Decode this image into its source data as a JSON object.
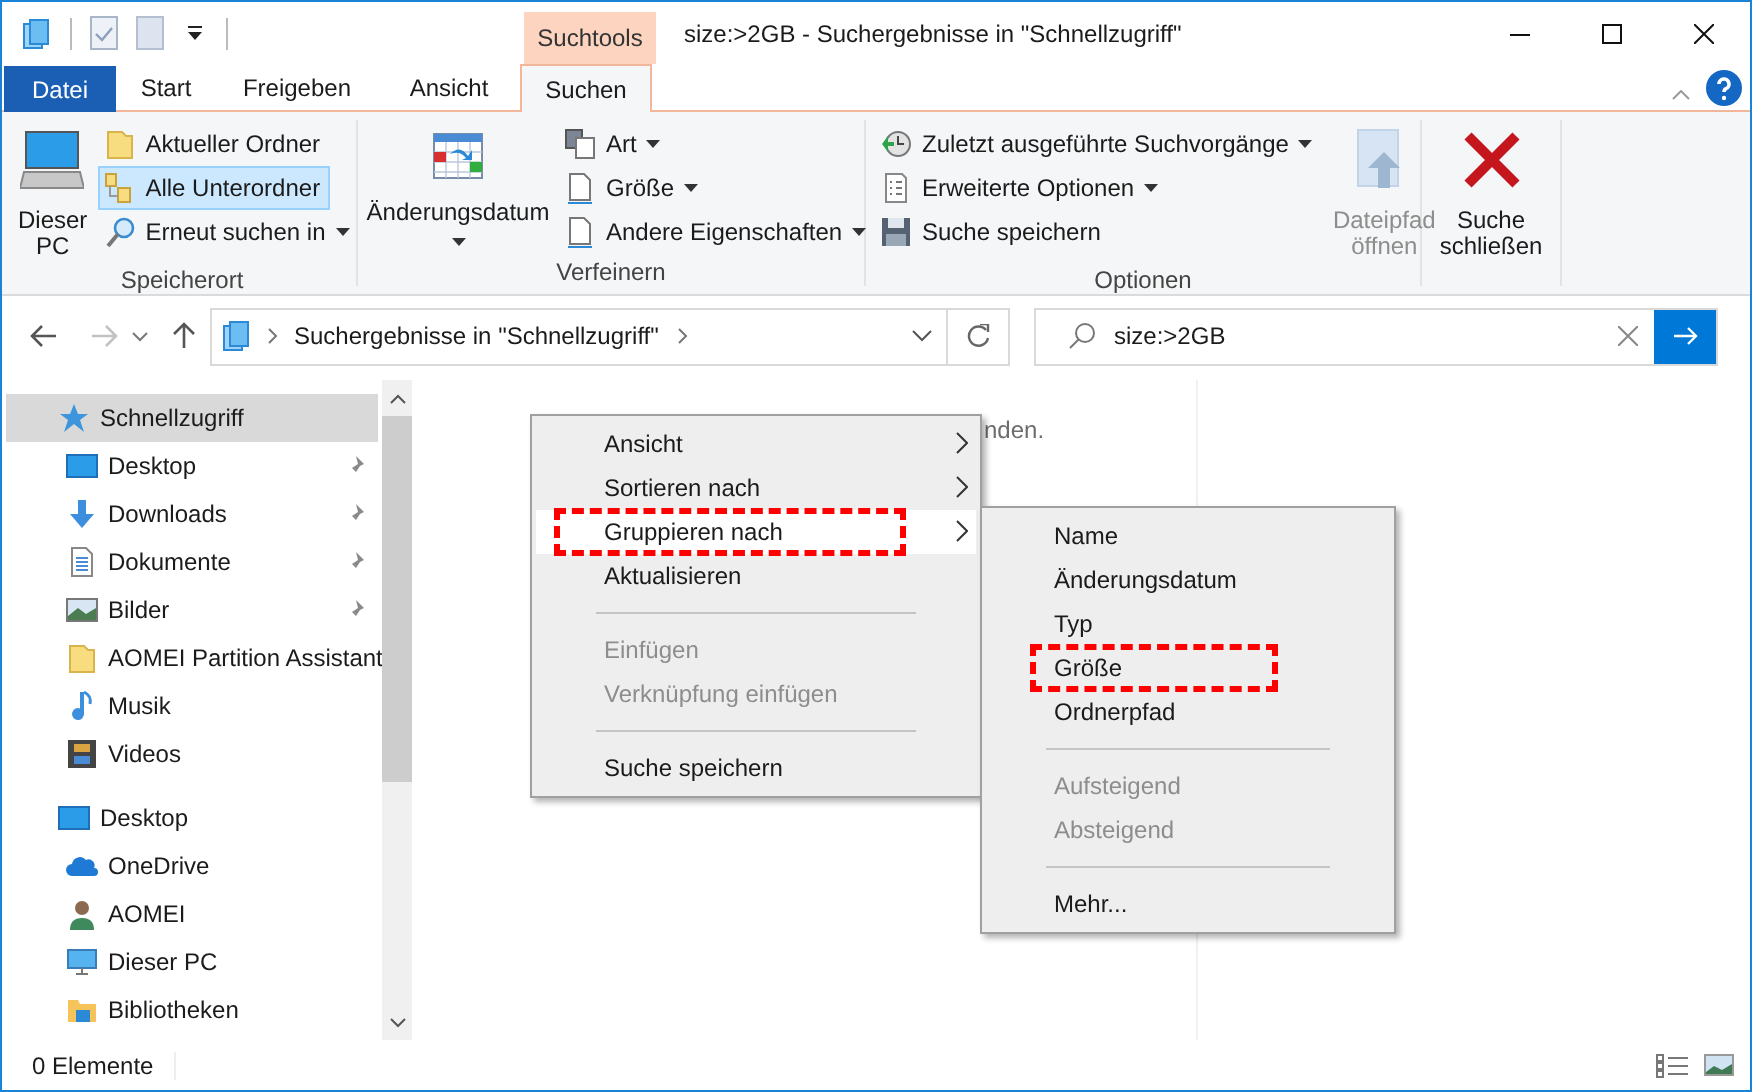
{
  "window": {
    "title": "size:>2GB - Suchergebnisse in \"Schnellzugriff\"",
    "contextual_tab": "Suchtools"
  },
  "ribbon_tabs": [
    {
      "label": "Datei",
      "kind": "file",
      "selected": false
    },
    {
      "label": "Start",
      "kind": "tab",
      "selected": false
    },
    {
      "label": "Freigeben",
      "kind": "tab",
      "selected": false
    },
    {
      "label": "Ansicht",
      "kind": "tab",
      "selected": false
    },
    {
      "label": "Suchen",
      "kind": "tab",
      "selected": true
    }
  ],
  "ribbon_groups": [
    {
      "label": "Speicherort",
      "items": [
        {
          "label": "Dieser PC",
          "kind": "large",
          "dropdown": false,
          "selected": false,
          "disabled": false
        },
        {
          "label": "Aktueller Ordner",
          "kind": "small",
          "dropdown": false,
          "selected": false,
          "disabled": false
        },
        {
          "label": "Alle Unterordner",
          "kind": "small",
          "dropdown": false,
          "selected": true,
          "disabled": false
        },
        {
          "label": "Erneut suchen in",
          "kind": "small",
          "dropdown": true,
          "selected": false,
          "disabled": false
        }
      ]
    },
    {
      "label": "Verfeinern",
      "items": [
        {
          "label": "Änderungsdatum",
          "kind": "large",
          "dropdown": true,
          "selected": false,
          "disabled": false
        },
        {
          "label": "Art",
          "kind": "small",
          "dropdown": true,
          "selected": false,
          "disabled": false
        },
        {
          "label": "Größe",
          "kind": "small",
          "dropdown": true,
          "selected": false,
          "disabled": false
        },
        {
          "label": "Andere Eigenschaften",
          "kind": "small",
          "dropdown": true,
          "selected": false,
          "disabled": false
        }
      ]
    },
    {
      "label": "Optionen",
      "items": [
        {
          "label": "Zuletzt ausgeführte Suchvorgänge",
          "kind": "small",
          "dropdown": true,
          "selected": false,
          "disabled": false
        },
        {
          "label": "Erweiterte Optionen",
          "kind": "small",
          "dropdown": true,
          "selected": false,
          "disabled": false
        },
        {
          "label": "Suche speichern",
          "kind": "small",
          "dropdown": false,
          "selected": false,
          "disabled": false
        },
        {
          "label": "Dateipfad öffnen",
          "kind": "large",
          "dropdown": false,
          "selected": false,
          "disabled": true
        }
      ]
    },
    {
      "items": [
        {
          "label": "Suche schließen",
          "kind": "large",
          "dropdown": false,
          "selected": false,
          "disabled": false
        }
      ]
    }
  ],
  "address_bar": {
    "path": "Suchergebnisse in \"Schnellzugriff\""
  },
  "search": {
    "value": "size:>2GB"
  },
  "navigation": [
    {
      "label": "Schnellzugriff",
      "selected": true,
      "children": [
        {
          "label": "Desktop",
          "pinned": true
        },
        {
          "label": "Downloads",
          "pinned": true
        },
        {
          "label": "Dokumente",
          "pinned": true
        },
        {
          "label": "Bilder",
          "pinned": true
        },
        {
          "label": "AOMEI Partition Assistant",
          "pinned": false
        },
        {
          "label": "Musik",
          "pinned": false
        },
        {
          "label": "Videos",
          "pinned": false
        }
      ]
    },
    {
      "label": "Desktop",
      "selected": false,
      "children": [
        {
          "label": "OneDrive",
          "pinned": false
        },
        {
          "label": "AOMEI",
          "pinned": false
        },
        {
          "label": "Dieser PC",
          "pinned": false
        },
        {
          "label": "Bibliotheken",
          "pinned": false
        }
      ]
    }
  ],
  "content_message": "nden.",
  "context_menu": [
    {
      "kind": "item",
      "label": "Ansicht",
      "submenu": true,
      "disabled": false,
      "selected": false,
      "annotated": false
    },
    {
      "kind": "item",
      "label": "Sortieren nach",
      "submenu": true,
      "disabled": false,
      "selected": false,
      "annotated": false
    },
    {
      "kind": "item",
      "label": "Gruppieren nach",
      "submenu": true,
      "disabled": false,
      "selected": true,
      "annotated": true
    },
    {
      "kind": "item",
      "label": "Aktualisieren",
      "submenu": false,
      "disabled": false,
      "selected": false,
      "annotated": false
    },
    {
      "kind": "separator"
    },
    {
      "kind": "item",
      "label": "Einfügen",
      "submenu": false,
      "disabled": true,
      "selected": false,
      "annotated": false
    },
    {
      "kind": "item",
      "label": "Verknüpfung einfügen",
      "submenu": false,
      "disabled": true,
      "selected": false,
      "annotated": false
    },
    {
      "kind": "separator"
    },
    {
      "kind": "item",
      "label": "Suche speichern",
      "submenu": false,
      "disabled": false,
      "selected": false,
      "annotated": false
    }
  ],
  "submenu": [
    {
      "kind": "item",
      "label": "Name",
      "disabled": false,
      "annotated": false
    },
    {
      "kind": "item",
      "label": "Änderungsdatum",
      "disabled": false,
      "annotated": false
    },
    {
      "kind": "item",
      "label": "Typ",
      "disabled": false,
      "annotated": false
    },
    {
      "kind": "item",
      "label": "Größe",
      "disabled": false,
      "annotated": true
    },
    {
      "kind": "item",
      "label": "Ordnerpfad",
      "disabled": false,
      "annotated": false
    },
    {
      "kind": "separator"
    },
    {
      "kind": "item",
      "label": "Aufsteigend",
      "disabled": true,
      "annotated": false
    },
    {
      "kind": "item",
      "label": "Absteigend",
      "disabled": true,
      "annotated": false
    },
    {
      "kind": "separator"
    },
    {
      "kind": "item",
      "label": "Mehr...",
      "disabled": false,
      "annotated": false
    }
  ],
  "status_bar": {
    "count": "0 Elemente"
  }
}
